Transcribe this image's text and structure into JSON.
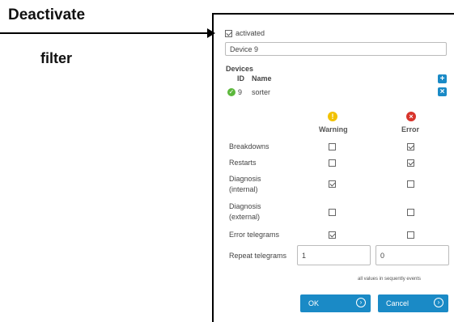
{
  "callout": {
    "title": "Deactivate",
    "subtitle": "filter"
  },
  "activated": {
    "label": "activated",
    "checked": true
  },
  "device_name": "Device 9",
  "devices": {
    "heading": "Devices",
    "col_id": "ID",
    "col_name": "Name",
    "rows": [
      {
        "id": "9",
        "name": "sorter",
        "status": "ok"
      }
    ],
    "add_icon": "plus-icon",
    "remove_icon": "close-icon"
  },
  "columns": {
    "warning": "Warning",
    "error": "Error"
  },
  "rows": [
    {
      "label": "Breakdowns",
      "label2": "",
      "warning": false,
      "error": true
    },
    {
      "label": "Restarts",
      "label2": "",
      "warning": false,
      "error": true
    },
    {
      "label": "Diagnosis",
      "label2": "(internal)",
      "warning": true,
      "error": false
    },
    {
      "label": "Diagnosis",
      "label2": "(external)",
      "warning": false,
      "error": false
    },
    {
      "label": "Error telegrams",
      "label2": "",
      "warning": true,
      "error": false
    }
  ],
  "repeat": {
    "label": "Repeat telegrams",
    "warning_value": "1",
    "error_value": "0"
  },
  "note": "all values in sequently events",
  "buttons": {
    "ok": "OK",
    "cancel": "Cancel"
  },
  "colors": {
    "accent": "#1a8ac6",
    "warning": "#f2c200",
    "error": "#d8342c",
    "ok": "#5cb83c"
  }
}
